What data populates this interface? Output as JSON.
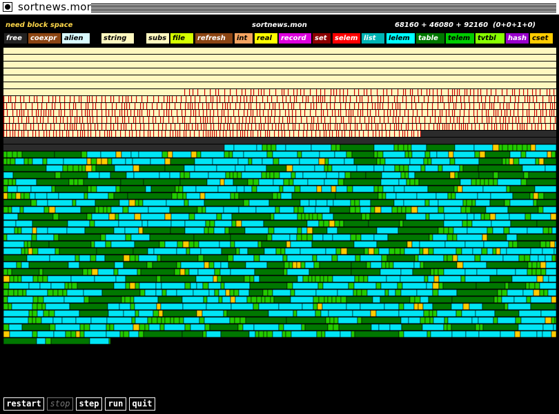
{
  "window": {
    "title": "sortnews.mon"
  },
  "status": {
    "message": "need block space",
    "file": "sortnews.mon",
    "stats": "68160 + 46080 + 92160  (0+0+1+0)"
  },
  "legend": [
    {
      "label": "free",
      "bg": "#222222",
      "fg": "#ffffff"
    },
    {
      "label": "coexpr",
      "bg": "#8b4513",
      "fg": "#ffffff"
    },
    {
      "label": "alien",
      "bg": "#d9fbff",
      "fg": "#000000"
    },
    {
      "label": "string",
      "bg": "#fff8c0",
      "fg": "#000000"
    },
    {
      "label": "subs",
      "bg": "#fff8c0",
      "fg": "#000000"
    },
    {
      "label": "file",
      "bg": "#d4ff00",
      "fg": "#000000"
    },
    {
      "label": "refresh",
      "bg": "#8b4513",
      "fg": "#ffffff"
    },
    {
      "label": "int",
      "bg": "#f4a460",
      "fg": "#000000"
    },
    {
      "label": "real",
      "bg": "#ffff00",
      "fg": "#000000"
    },
    {
      "label": "record",
      "bg": "#dd00dd",
      "fg": "#ffffff"
    },
    {
      "label": "set",
      "bg": "#8b0000",
      "fg": "#ffffff"
    },
    {
      "label": "selem",
      "bg": "#ff0000",
      "fg": "#ffffff"
    },
    {
      "label": "list",
      "bg": "#00b4b4",
      "fg": "#ffffff"
    },
    {
      "label": "lelem",
      "bg": "#00ffff",
      "fg": "#000000"
    },
    {
      "label": "table",
      "bg": "#007700",
      "fg": "#ffffff"
    },
    {
      "label": "telem",
      "bg": "#00cc00",
      "fg": "#000000"
    },
    {
      "label": "tvtbl",
      "bg": "#88ff00",
      "fg": "#000000"
    },
    {
      "label": "hash",
      "bg": "#9900cc",
      "fg": "#ffffff"
    },
    {
      "label": "cset",
      "bg": "#ffcc00",
      "fg": "#000000"
    }
  ],
  "heap_colors": {
    "string": "#fff8c0",
    "string_mark": "#cc0000",
    "free": "#2b2b2b",
    "lelem": "#00e5f5",
    "telem": "#22cc00",
    "table": "#007700",
    "cset": "#ffcc00",
    "divider": "#000000"
  },
  "buttons": [
    {
      "label": "restart",
      "enabled": true
    },
    {
      "label": "stop",
      "enabled": false
    },
    {
      "label": "step",
      "enabled": true
    },
    {
      "label": "run",
      "enabled": true
    },
    {
      "label": "quit",
      "enabled": true
    }
  ]
}
